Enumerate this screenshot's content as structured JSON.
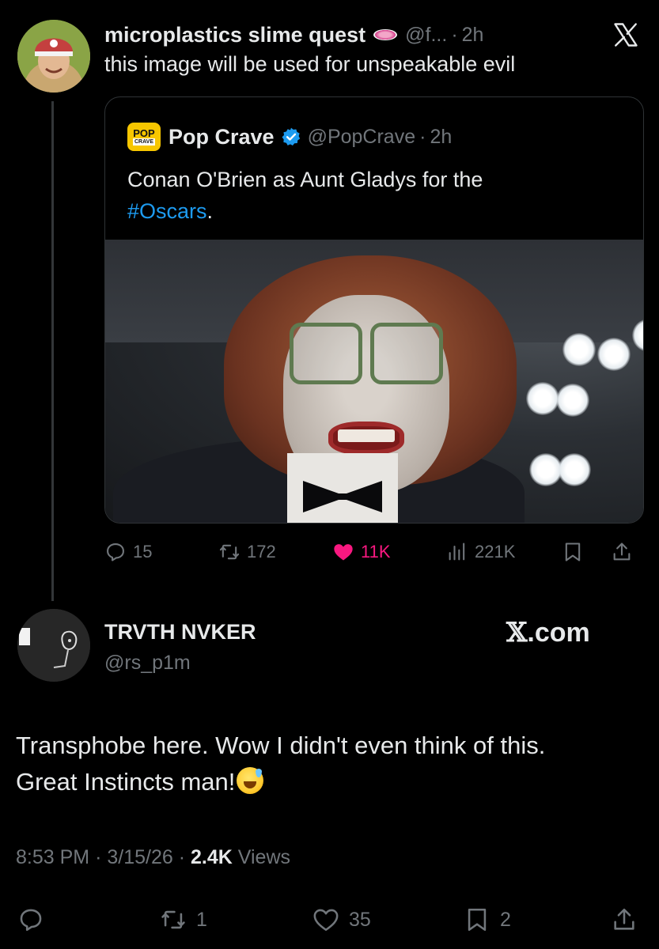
{
  "parent_tweet": {
    "author_name": "microplastics slime quest",
    "author_emoji": "petri-dish-emoji",
    "handle": "@f...",
    "dot": "·",
    "time": "2h",
    "text": "this image will be used for unspeakable evil",
    "header_icon": "x-logo-icon",
    "actions": {
      "reply_count": "15",
      "repost_count": "172",
      "like_count": "11K",
      "view_count": "221K"
    }
  },
  "quoted_tweet": {
    "logo_line1": "POP",
    "logo_line2": "CRAVE",
    "author_name": "Pop Crave",
    "verified": true,
    "handle": "@PopCrave",
    "dot": "·",
    "time": "2h",
    "text_main": "Conan O'Brien as Aunt Gladys for the",
    "hashtag": "#Oscars",
    "text_end": "."
  },
  "reply_tweet": {
    "author_name": "TRVTH NVKER",
    "handle": "@rs_p1m",
    "watermark_x": "𝕏",
    "watermark_domain": ".com",
    "text_line1": "Transphobe here. Wow I didn't even think of this.",
    "text_line2": "Great Instincts man!",
    "text_emoji": "grinning-face-with-sweat-emoji",
    "time": "8:53 PM",
    "date": "3/15/26",
    "views_count": "2.4K",
    "views_label": "Views",
    "sep": "·",
    "actions": {
      "repost_count": "1",
      "like_count": "35",
      "bookmark_count": "2"
    }
  },
  "colors": {
    "background": "#000000",
    "text": "#e7e9ea",
    "muted": "#71767b",
    "link": "#1d9bf0",
    "like": "#f91880",
    "border": "#2f3336"
  }
}
